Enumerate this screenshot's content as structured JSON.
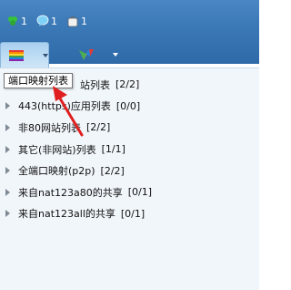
{
  "status": {
    "green_count": "1",
    "msg_count": "1",
    "bag_count": "1"
  },
  "toolbar": {
    "buttons": [
      {
        "icon": "rainbow-flag-icon"
      },
      {
        "icon": "colorful-v-icon"
      }
    ]
  },
  "tooltip": "端口映射列表",
  "list": [
    {
      "label": "站列表",
      "count": "[2/2]"
    },
    {
      "label": "443(https)应用列表",
      "count": "[0/0]"
    },
    {
      "label": "非80网站列表",
      "count": "[2/2]"
    },
    {
      "label": "其它(非网站)列表",
      "count": "[1/1]"
    },
    {
      "label": "全端口映射(p2p)",
      "count": "[2/2]"
    },
    {
      "label": "来自nat123a80的共享",
      "count": "[0/1]"
    },
    {
      "label": "来自nat123all的共享",
      "count": "[0/1]"
    }
  ],
  "colors": {
    "header_blue": "#3d7ab8",
    "content_bg": "#f1f6fb",
    "annotation_red": "#e02020"
  }
}
